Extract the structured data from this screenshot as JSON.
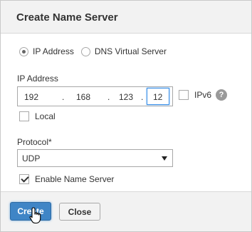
{
  "dialog": {
    "title": "Create Name Server"
  },
  "type_options": [
    {
      "label": "IP Address",
      "selected": true
    },
    {
      "label": "DNS Virtual Server",
      "selected": false
    }
  ],
  "ip": {
    "label": "IP Address",
    "octets": [
      "192",
      "168",
      "123",
      "12"
    ],
    "ipv6_label": "IPv6",
    "ipv6_checked": false,
    "help_glyph": "?"
  },
  "local": {
    "label": "Local",
    "checked": false
  },
  "protocol": {
    "label": "Protocol*",
    "value": "UDP"
  },
  "enable": {
    "label": "Enable Name Server",
    "checked": true
  },
  "buttons": {
    "create": "Create",
    "close": "Close"
  },
  "colors": {
    "primary": "#3f85c6",
    "focus": "#3a8ee6"
  }
}
